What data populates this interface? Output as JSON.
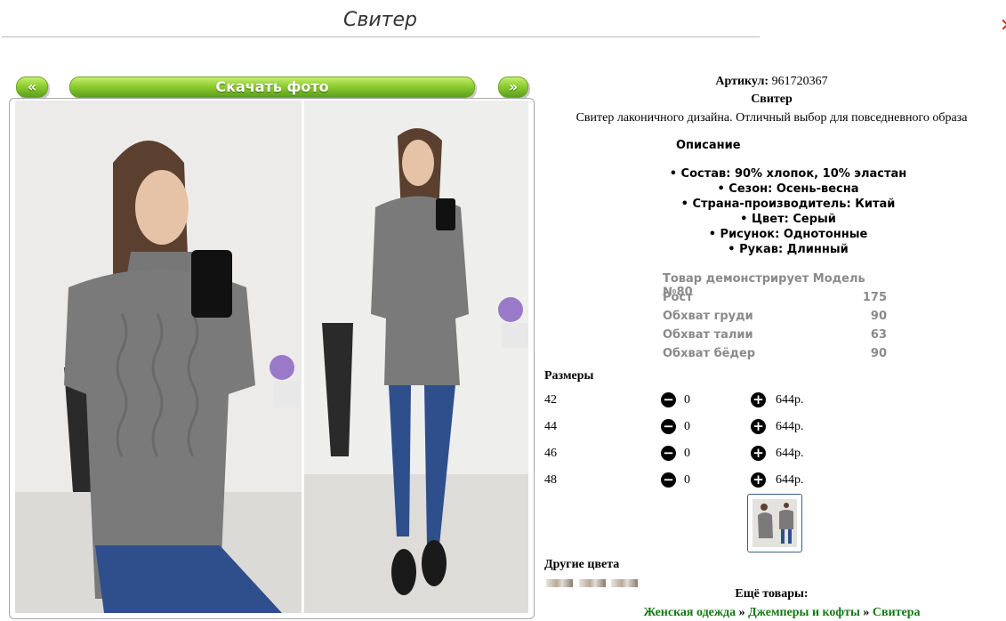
{
  "header": {
    "title": "Свитер"
  },
  "gallery": {
    "prev_label": "«",
    "download_label": "Скачать фото",
    "next_label": "»"
  },
  "product": {
    "sku_label": "Артикул:",
    "sku_value": "961720367",
    "name": "Свитер",
    "short_description": "Свитер лаконичного дизайна. Отличный выбор для повседневного образа",
    "description_heading": "Описание",
    "features": [
      "Состав: 90% хлопок, 10% эластан",
      "Сезон: Осень-весна",
      "Страна-производитель: Китай",
      "Цвет: Серый",
      "Рисунок: Однотонные",
      "Рукав: Длинный"
    ]
  },
  "model": {
    "rows": [
      {
        "label": "Товар демонстрирует Модель №80",
        "value": ""
      },
      {
        "label": "Рост",
        "value": "175"
      },
      {
        "label": "Обхват груди",
        "value": "90"
      },
      {
        "label": "Обхват талии",
        "value": "63"
      },
      {
        "label": "Обхват бёдер",
        "value": "90"
      }
    ]
  },
  "sizes": {
    "heading": "Размеры",
    "rows": [
      {
        "size": "42",
        "qty": "0",
        "price": "644р."
      },
      {
        "size": "44",
        "qty": "0",
        "price": "644р."
      },
      {
        "size": "46",
        "qty": "0",
        "price": "644р."
      },
      {
        "size": "48",
        "qty": "0",
        "price": "644р."
      }
    ]
  },
  "other_colors": {
    "heading": "Другие цвета"
  },
  "more": {
    "heading": "Ещё товары:"
  },
  "breadcrumbs": [
    {
      "label": "Женская одежда"
    },
    {
      "label": "Джемперы и кофты"
    },
    {
      "label": "Свитера"
    }
  ],
  "breadcrumb_separator": "»",
  "colors": {
    "button_green": "#8ccd2f",
    "link_green": "#107a10",
    "sweater_grey": "#7a7a7a"
  }
}
